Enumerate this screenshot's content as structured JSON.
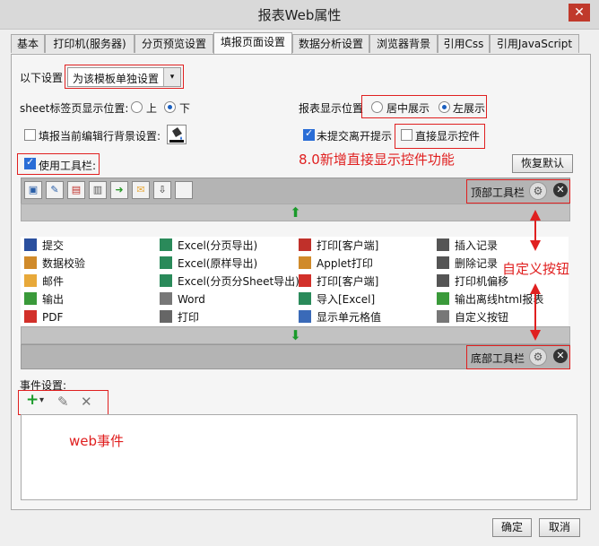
{
  "window": {
    "title": "报表Web属性",
    "close_symbol": "✕"
  },
  "tabs": [
    {
      "label": "基本"
    },
    {
      "label": "打印机(服务器)"
    },
    {
      "label": "分页预览设置"
    },
    {
      "label": "填报页面设置",
      "active": true
    },
    {
      "label": "数据分析设置"
    },
    {
      "label": "浏览器背景"
    },
    {
      "label": "引用Css"
    },
    {
      "label": "引用JavaScript"
    }
  ],
  "settings": {
    "scope_label": "以下设置",
    "scope_value": "为该模板单独设置",
    "sheet_tab_label": "sheet标签页显示位置:",
    "sheet_tab_options": [
      "上",
      "下"
    ],
    "sheet_tab_selected": "下",
    "report_pos_label": "报表显示位置",
    "report_pos_options": [
      "居中展示",
      "左展示"
    ],
    "report_pos_selected": "左展示",
    "fill_bg_label": "填报当前编辑行背景设置:",
    "fill_bg_checked": false,
    "unsubmitted_label": "未提交离开提示",
    "unsubmitted_checked": true,
    "direct_display_label": "直接显示控件",
    "direct_display_checked": false,
    "use_toolbar_label": "使用工具栏:",
    "use_toolbar_checked": true,
    "restore_default": "恢复默认"
  },
  "top_toolbar": {
    "label": "顶部工具栏",
    "icons": [
      "save-icon",
      "edit-icon",
      "pdf-icon",
      "print-icon",
      "export-icon",
      "mail-icon",
      "upload-icon",
      "blank-icon"
    ]
  },
  "bottom_toolbar": {
    "label": "底部工具栏"
  },
  "arrow_glyphs": {
    "up": "⬆",
    "down": "⬇",
    "gear": "⚙",
    "x": "✕"
  },
  "buttons_grid": [
    [
      {
        "label": "提交",
        "icon": "save-icon",
        "color": "#2a4f9e"
      },
      {
        "label": "数据校验",
        "icon": "check-pencil-icon",
        "color": "#d08a2a"
      },
      {
        "label": "邮件",
        "icon": "mail-icon",
        "color": "#e8a93a"
      },
      {
        "label": "输出",
        "icon": "export-icon",
        "color": "#3a9a3a"
      },
      {
        "label": "PDF",
        "icon": "pdf-icon",
        "color": "#d2302a"
      }
    ],
    [
      {
        "label": "Excel(分页导出)",
        "icon": "excel-icon",
        "color": "#2a8a5a"
      },
      {
        "label": "Excel(原样导出)",
        "icon": "excel-icon",
        "color": "#2a8a5a"
      },
      {
        "label": "Excel(分页分Sheet导出)",
        "icon": "excel-icon",
        "color": "#2a8a5a"
      },
      {
        "label": "Word",
        "icon": "word-icon",
        "color": "#777777"
      },
      {
        "label": "打印",
        "icon": "print-icon",
        "color": "#666666"
      }
    ],
    [
      {
        "label": "打印[客户端]",
        "icon": "print-client-icon",
        "color": "#c0302a"
      },
      {
        "label": "Applet打印",
        "icon": "applet-icon",
        "color": "#d08a2a"
      },
      {
        "label": "打印[客户端]",
        "icon": "pdf-print-icon",
        "color": "#d2302a"
      },
      {
        "label": "导入[Excel]",
        "icon": "excel-import-icon",
        "color": "#2a8a5a"
      },
      {
        "label": "显示单元格值",
        "icon": "cell-icon",
        "color": "#3a6ab8"
      }
    ],
    [
      {
        "label": "插入记录",
        "icon": "insert-row-icon",
        "color": "#555555"
      },
      {
        "label": "删除记录",
        "icon": "delete-row-icon",
        "color": "#555555"
      },
      {
        "label": "打印机偏移",
        "icon": "move-icon",
        "color": "#555555"
      },
      {
        "label": "输出离线html报表",
        "icon": "offline-html-icon",
        "color": "#3a9a3a"
      },
      {
        "label": "自定义按钮",
        "icon": "gear-icon",
        "color": "#777777"
      }
    ]
  ],
  "events": {
    "label": "事件设置:",
    "add_symbol": "+",
    "dropdown_symbol": "▾",
    "edit_symbol": "✎",
    "delete_symbol": "✕"
  },
  "footer": {
    "ok": "确定",
    "cancel": "取消"
  },
  "annotations": {
    "direct_display": "8.0新增直接显示控件功能",
    "custom_button": "自定义按钮",
    "web_event": "web事件",
    "color": "#e02020"
  }
}
